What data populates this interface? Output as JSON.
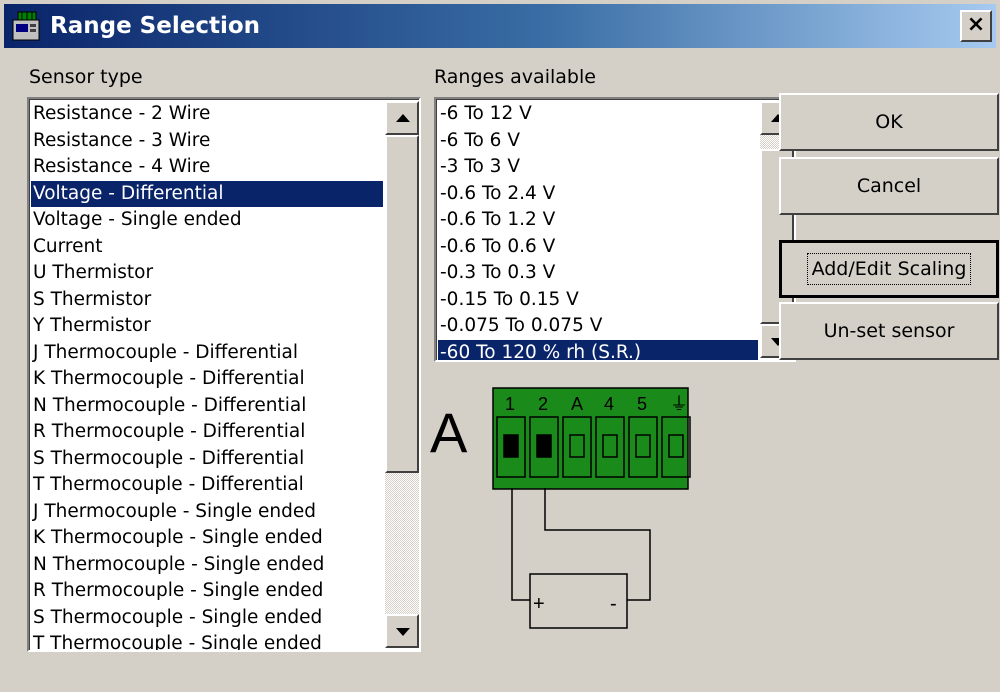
{
  "window": {
    "title": "Range Selection",
    "close_label": "×"
  },
  "sensor": {
    "label": "Sensor type",
    "items": [
      "Resistance - 2 Wire",
      "Resistance - 3 Wire",
      "Resistance - 4 Wire",
      "Voltage - Differential",
      "Voltage - Single ended",
      "Current",
      "U  Thermistor",
      "S  Thermistor",
      "Y  Thermistor",
      "J Thermocouple - Differential",
      "K Thermocouple - Differential",
      "N Thermocouple - Differential",
      "R Thermocouple - Differential",
      "S Thermocouple - Differential",
      "T Thermocouple - Differential",
      "J Thermocouple - Single ended",
      "K Thermocouple - Single ended",
      "N Thermocouple - Single ended",
      "R Thermocouple - Single ended",
      "S Thermocouple - Single ended",
      "T Thermocouple - Single ended"
    ],
    "selected_index": 3
  },
  "ranges": {
    "label": "Ranges available",
    "items": [
      "-6 To 12 V",
      "-6 To 6 V",
      "-3 To 3 V",
      "-0.6 To 2.4 V",
      "-0.6 To 1.2 V",
      "-0.6 To 0.6 V",
      "-0.3 To 0.3 V",
      "-0.15 To 0.15 V",
      "-0.075 To 0.075 V",
      "-60 To 120 % rh (S.R.)"
    ],
    "selected_index": 9
  },
  "buttons": {
    "ok": "OK",
    "cancel": "Cancel",
    "add_edit_scaling": "Add/Edit Scaling",
    "unset_sensor": "Un-set sensor"
  },
  "diagram": {
    "channel_letter": "A",
    "terminal_labels": [
      "1",
      "2",
      "A",
      "4",
      "5",
      "⏚"
    ],
    "plus_label": "+",
    "minus_label": "-",
    "block_color": "#1a8a1a"
  },
  "colors": {
    "face": "#d4d0c8",
    "selection": "#0a246a",
    "title_start": "#0a246a",
    "title_end": "#a6caf0"
  }
}
